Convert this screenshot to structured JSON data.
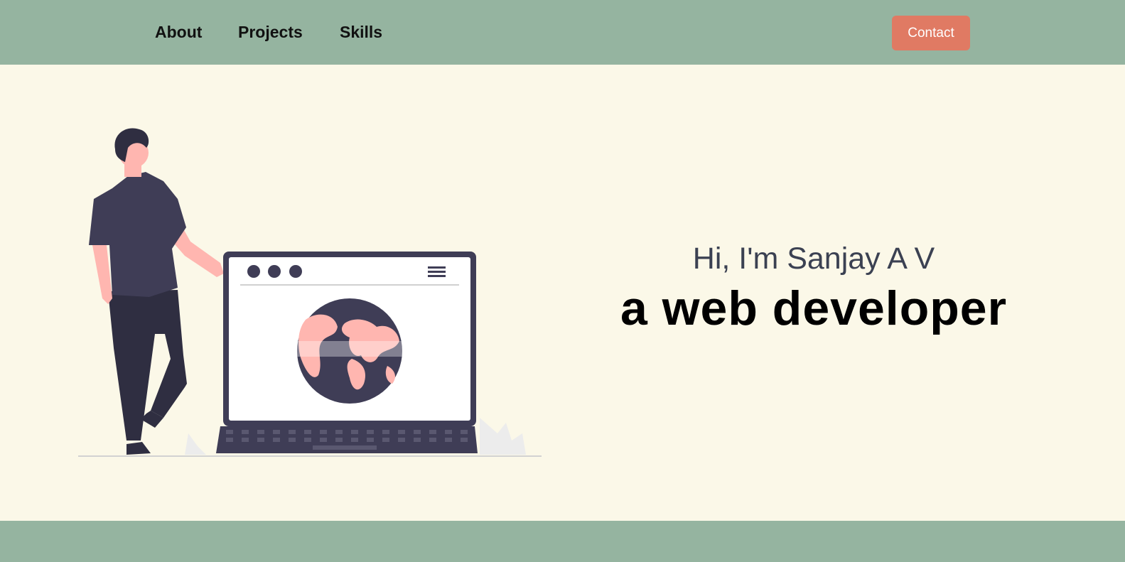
{
  "nav": {
    "links": [
      {
        "label": "About"
      },
      {
        "label": "Projects"
      },
      {
        "label": "Skills"
      }
    ],
    "contact_label": "Contact"
  },
  "hero": {
    "greeting": "Hi, I'm Sanjay A V",
    "role": "a web developer",
    "illustration_icon": "developer-with-laptop-globe-illustration"
  },
  "colors": {
    "nav_background": "#95b4a0",
    "page_background": "#fbf8e8",
    "accent": "#e07a63",
    "illustration_dark": "#3f3d56",
    "illustration_skin": "#ffb6b0"
  }
}
